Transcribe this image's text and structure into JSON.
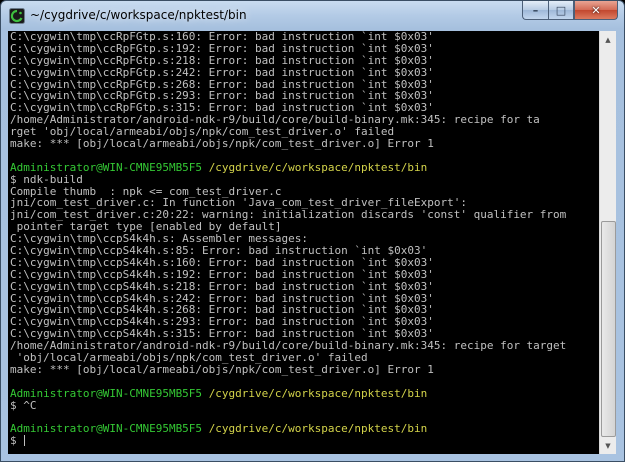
{
  "window": {
    "title": "~/cygdrive/c/workspace/npktest/bin",
    "min_glyph": "–",
    "max_glyph": "□",
    "close_glyph": "✕"
  },
  "colors": {
    "terminal_bg": "#000000",
    "text": "#c0c0c0",
    "prompt_user": "#34c934",
    "prompt_path": "#d3d34a"
  },
  "terminal": {
    "lines": [
      {
        "type": "text",
        "text": "C:\\cygwin\\tmp\\ccRpFGtp.s:160: Error: bad instruction `int $0x03'"
      },
      {
        "type": "text",
        "text": "C:\\cygwin\\tmp\\ccRpFGtp.s:192: Error: bad instruction `int $0x03'"
      },
      {
        "type": "text",
        "text": "C:\\cygwin\\tmp\\ccRpFGtp.s:218: Error: bad instruction `int $0x03'"
      },
      {
        "type": "text",
        "text": "C:\\cygwin\\tmp\\ccRpFGtp.s:242: Error: bad instruction `int $0x03'"
      },
      {
        "type": "text",
        "text": "C:\\cygwin\\tmp\\ccRpFGtp.s:268: Error: bad instruction `int $0x03'"
      },
      {
        "type": "text",
        "text": "C:\\cygwin\\tmp\\ccRpFGtp.s:293: Error: bad instruction `int $0x03'"
      },
      {
        "type": "text",
        "text": "C:\\cygwin\\tmp\\ccRpFGtp.s:315: Error: bad instruction `int $0x03'"
      },
      {
        "type": "text",
        "text": "/home/Administrator/android-ndk-r9/build/core/build-binary.mk:345: recipe for ta"
      },
      {
        "type": "text",
        "text": "rget 'obj/local/armeabi/objs/npk/com_test_driver.o' failed"
      },
      {
        "type": "text",
        "text": "make: *** [obj/local/armeabi/objs/npk/com_test_driver.o] Error 1"
      },
      {
        "type": "text",
        "text": ""
      },
      {
        "type": "prompt",
        "user": "Administrator@WIN-CMNE95MB5F5",
        "path": "/cygdrive/c/workspace/npktest/bin"
      },
      {
        "type": "text",
        "text": "$ ndk-build"
      },
      {
        "type": "text",
        "text": "Compile thumb  : npk <= com_test_driver.c"
      },
      {
        "type": "text",
        "text": "jni/com_test_driver.c: In function 'Java_com_test_driver_fileExport':"
      },
      {
        "type": "text",
        "text": "jni/com_test_driver.c:20:22: warning: initialization discards 'const' qualifier from"
      },
      {
        "type": "text",
        "text": " pointer target type [enabled by default]"
      },
      {
        "type": "text",
        "text": "C:\\cygwin\\tmp\\ccpS4k4h.s: Assembler messages:"
      },
      {
        "type": "text",
        "text": "C:\\cygwin\\tmp\\ccpS4k4h.s:85: Error: bad instruction `int $0x03'"
      },
      {
        "type": "text",
        "text": "C:\\cygwin\\tmp\\ccpS4k4h.s:160: Error: bad instruction `int $0x03'"
      },
      {
        "type": "text",
        "text": "C:\\cygwin\\tmp\\ccpS4k4h.s:192: Error: bad instruction `int $0x03'"
      },
      {
        "type": "text",
        "text": "C:\\cygwin\\tmp\\ccpS4k4h.s:218: Error: bad instruction `int $0x03'"
      },
      {
        "type": "text",
        "text": "C:\\cygwin\\tmp\\ccpS4k4h.s:242: Error: bad instruction `int $0x03'"
      },
      {
        "type": "text",
        "text": "C:\\cygwin\\tmp\\ccpS4k4h.s:268: Error: bad instruction `int $0x03'"
      },
      {
        "type": "text",
        "text": "C:\\cygwin\\tmp\\ccpS4k4h.s:293: Error: bad instruction `int $0x03'"
      },
      {
        "type": "text",
        "text": "C:\\cygwin\\tmp\\ccpS4k4h.s:315: Error: bad instruction `int $0x03'"
      },
      {
        "type": "text",
        "text": "/home/Administrator/android-ndk-r9/build/core/build-binary.mk:345: recipe for target"
      },
      {
        "type": "text",
        "text": " 'obj/local/armeabi/objs/npk/com_test_driver.o' failed"
      },
      {
        "type": "text",
        "text": "make: *** [obj/local/armeabi/objs/npk/com_test_driver.o] Error 1"
      },
      {
        "type": "text",
        "text": ""
      },
      {
        "type": "prompt",
        "user": "Administrator@WIN-CMNE95MB5F5",
        "path": "/cygdrive/c/workspace/npktest/bin"
      },
      {
        "type": "text",
        "text": "$ ^C"
      },
      {
        "type": "text",
        "text": ""
      },
      {
        "type": "prompt",
        "user": "Administrator@WIN-CMNE95MB5F5",
        "path": "/cygdrive/c/workspace/npktest/bin"
      },
      {
        "type": "input",
        "text": "$ "
      }
    ]
  },
  "scrollbar": {
    "up_glyph": "▲",
    "down_glyph": "▼"
  }
}
